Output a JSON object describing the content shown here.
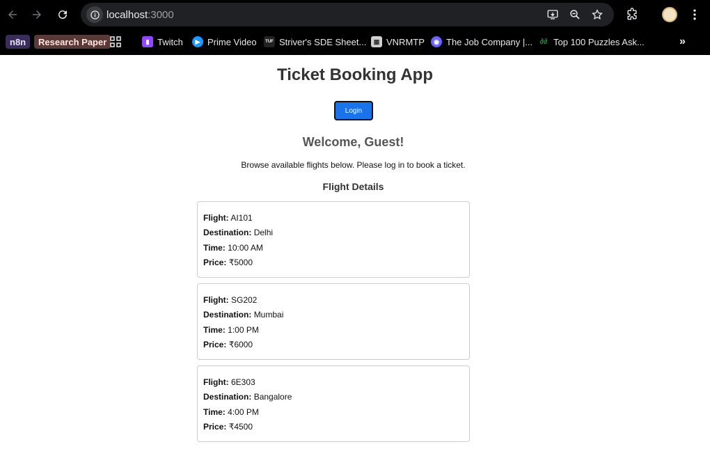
{
  "browser": {
    "url_host": "localhost",
    "url_port": ":3000"
  },
  "bookmarks": [
    {
      "label": "n8n",
      "kind": "chip",
      "bg": "#3b2d5a",
      "color": "#e9e3ff"
    },
    {
      "label": "Research Paper",
      "kind": "chip",
      "bg": "#5a3a36",
      "color": "#ffe4df"
    },
    {
      "label": "",
      "kind": "apps-icon"
    },
    {
      "label": "Twitch",
      "icon": "twitch-icon",
      "color": "#9146ff"
    },
    {
      "label": "Prime Video",
      "icon": "prime-video-icon",
      "color": "#1a98ff"
    },
    {
      "label": "Striver's SDE Sheet...",
      "icon": "tuf-icon",
      "color": "#222222"
    },
    {
      "label": "VNRMTP",
      "icon": "vnr-icon",
      "color": "#d0d0d0"
    },
    {
      "label": "The Job Company |...",
      "icon": "job-company-icon",
      "color": "#6c63ff"
    },
    {
      "label": "Top 100 Puzzles Ask...",
      "icon": "gfg-icon",
      "color": "#2f8d46"
    }
  ],
  "app": {
    "title": "Ticket Booking App",
    "login_label": "Login",
    "welcome": "Welcome, Guest!",
    "browse_text": "Browse available flights below. Please log in to book a ticket.",
    "details_title": "Flight Details",
    "labels": {
      "flight": "Flight:",
      "destination": "Destination:",
      "time": "Time:",
      "price": "Price:"
    },
    "flights": [
      {
        "flight": "AI101",
        "destination": "Delhi",
        "time": "10:00 AM",
        "price": "₹5000"
      },
      {
        "flight": "SG202",
        "destination": "Mumbai",
        "time": "1:00 PM",
        "price": "₹6000"
      },
      {
        "flight": "6E303",
        "destination": "Bangalore",
        "time": "4:00 PM",
        "price": "₹4500"
      }
    ]
  },
  "colors": {
    "accent": "#1a73e8",
    "chrome_bg": "#000000",
    "omnibox_bg": "#202124"
  }
}
